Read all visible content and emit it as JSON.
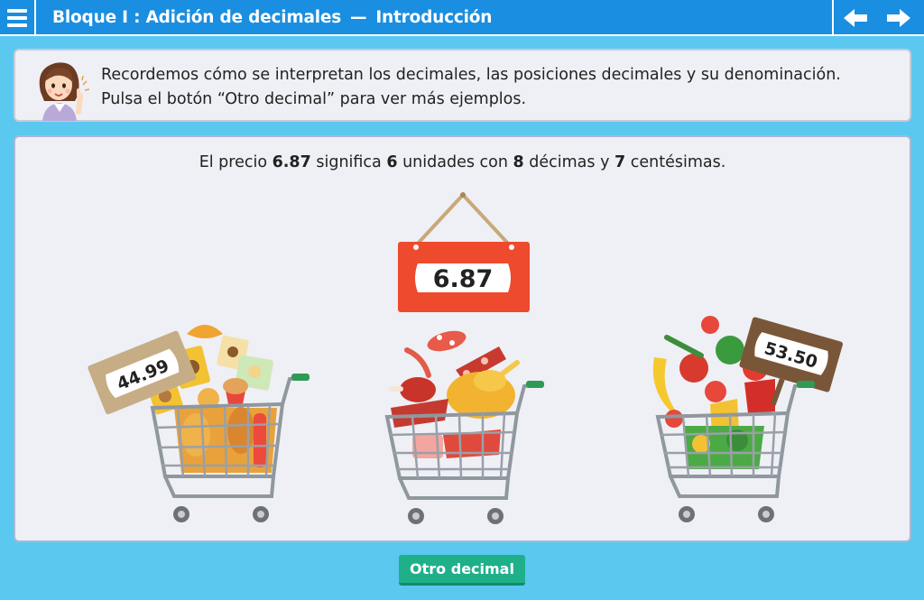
{
  "header": {
    "menu_icon": "hamburger-menu-icon",
    "title_part1": "Bloque I : Adición de decimales",
    "title_dash": "—",
    "title_part2": "Introducción",
    "prev_icon": "arrow-left-icon",
    "next_icon": "arrow-right-icon",
    "bar_color": "#1a8ee0"
  },
  "instruction": {
    "avatar_icon": "teacher-avatar-icon",
    "line1": "Recordemos cómo se interpretan los decimales, las posiciones decimales y su denominación.",
    "line2": "Pulsa el botón “Otro decimal” para ver más ejemplos."
  },
  "explanation": {
    "t1": "El precio ",
    "price": "6.87",
    "t2": " significa ",
    "units": "6",
    "t3": " unidades con ",
    "tenths": "8",
    "t4": " décimas y ",
    "hundredths": "7",
    "t5": " centésimas."
  },
  "main_sign": {
    "value": "6.87",
    "color": "#ee4a2d"
  },
  "carts": [
    {
      "name": "bakery-cart",
      "price": "44.99",
      "icon": "bakery-groceries-icon"
    },
    {
      "name": "meat-cart",
      "price": "",
      "icon": "meat-groceries-icon"
    },
    {
      "name": "produce-cart",
      "price": "53.50",
      "icon": "produce-groceries-icon"
    }
  ],
  "actions": {
    "other_decimal": "Otro decimal",
    "button_color": "#1fb08a"
  }
}
